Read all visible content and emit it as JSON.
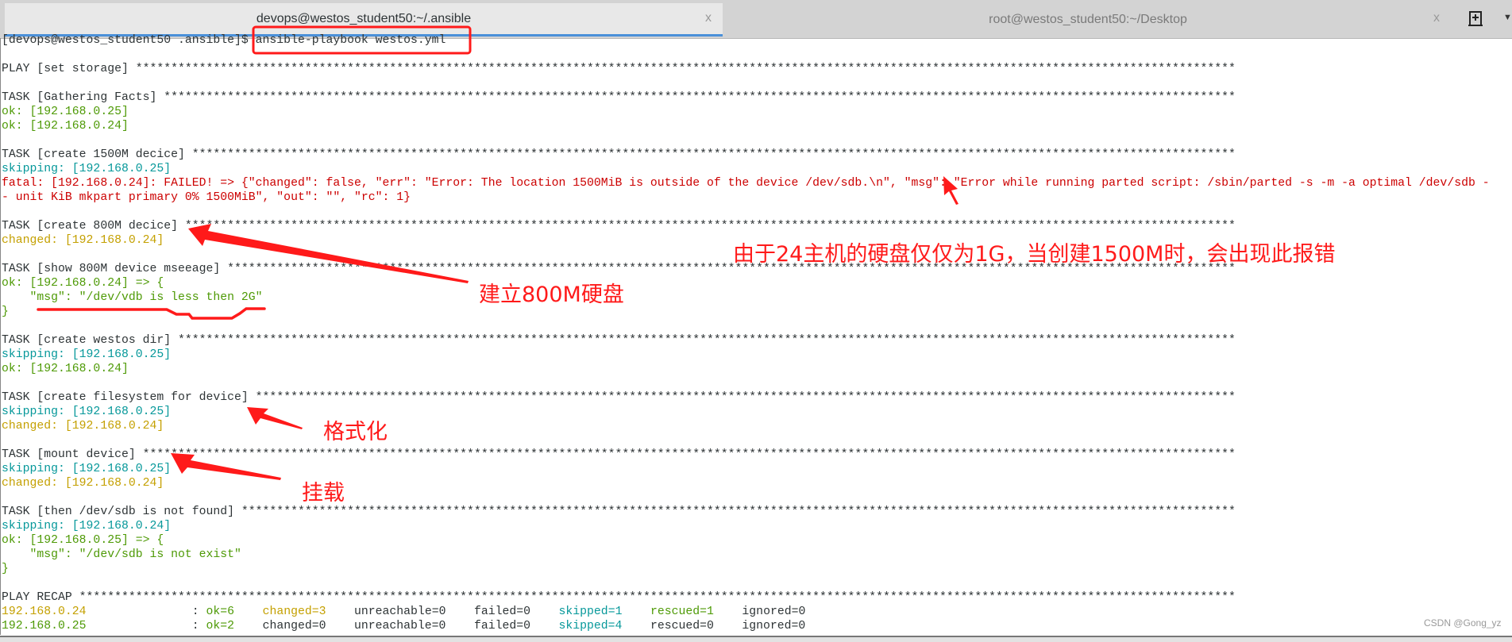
{
  "tabs": [
    {
      "title": "devops@westos_student50:~/.ansible",
      "active": true,
      "close": "x"
    },
    {
      "title": "root@westos_student50:~/Desktop",
      "active": false,
      "close": "x"
    }
  ],
  "icons": {
    "new_tab": "new-tab-icon",
    "menu": "chevron-down-icon"
  },
  "colors": {
    "ok": "#4e9a06",
    "skipping": "#06989a",
    "changed": "#c4a000",
    "fatal": "#cc0000",
    "annotation": "#ff1a1a",
    "tab_accent": "#4a90d9"
  },
  "terminal": {
    "rule_char": "*",
    "lines": [
      [
        {
          "t": "[devops@westos_student50 .ansible]$ ansible-playbook westos.yml",
          "c": "grey"
        }
      ],
      [],
      [
        {
          "t": "PLAY [set storage]",
          "c": "grey",
          "rule": true
        }
      ],
      [],
      [
        {
          "t": "TASK [Gathering Facts]",
          "c": "grey",
          "rule": true
        }
      ],
      [
        {
          "t": "ok: [192.168.0.25]",
          "c": "green"
        }
      ],
      [
        {
          "t": "ok: [192.168.0.24]",
          "c": "green"
        }
      ],
      [],
      [
        {
          "t": "TASK [create 1500M decice]",
          "c": "grey",
          "rule": true
        }
      ],
      [
        {
          "t": "skipping: [192.168.0.25]",
          "c": "cyan"
        }
      ],
      [
        {
          "t": "fatal: [192.168.0.24]: FAILED! => {\"changed\": false, \"err\": \"Error: The location 1500MiB is outside of the device /dev/sdb.\\n\", \"msg\": \"Error while running parted script: /sbin/parted -s -m -a optimal /dev/sdb -",
          "c": "red"
        }
      ],
      [
        {
          "t": "- unit KiB mkpart primary 0% 1500MiB\", \"out\": \"\", \"rc\": 1}",
          "c": "red"
        }
      ],
      [],
      [
        {
          "t": "TASK [create 800M decice]",
          "c": "grey",
          "rule": true
        }
      ],
      [
        {
          "t": "changed: [192.168.0.24]",
          "c": "yellow"
        }
      ],
      [],
      [
        {
          "t": "TASK [show 800M device mseeage]",
          "c": "grey",
          "rule": true
        }
      ],
      [
        {
          "t": "ok: [192.168.0.24] => {",
          "c": "green"
        }
      ],
      [
        {
          "t": "    \"msg\": \"/dev/vdb is less then 2G\"",
          "c": "green"
        }
      ],
      [
        {
          "t": "}",
          "c": "green"
        }
      ],
      [],
      [
        {
          "t": "TASK [create westos dir]",
          "c": "grey",
          "rule": true
        }
      ],
      [
        {
          "t": "skipping: [192.168.0.25]",
          "c": "cyan"
        }
      ],
      [
        {
          "t": "ok: [192.168.0.24]",
          "c": "green"
        }
      ],
      [],
      [
        {
          "t": "TASK [create filesystem for device]",
          "c": "grey",
          "rule": true
        }
      ],
      [
        {
          "t": "skipping: [192.168.0.25]",
          "c": "cyan"
        }
      ],
      [
        {
          "t": "changed: [192.168.0.24]",
          "c": "yellow"
        }
      ],
      [],
      [
        {
          "t": "TASK [mount device]",
          "c": "grey",
          "rule": true
        }
      ],
      [
        {
          "t": "skipping: [192.168.0.25]",
          "c": "cyan"
        }
      ],
      [
        {
          "t": "changed: [192.168.0.24]",
          "c": "yellow"
        }
      ],
      [],
      [
        {
          "t": "TASK [then /dev/sdb is not found]",
          "c": "grey",
          "rule": true
        }
      ],
      [
        {
          "t": "skipping: [192.168.0.24]",
          "c": "cyan"
        }
      ],
      [
        {
          "t": "ok: [192.168.0.25] => {",
          "c": "green"
        }
      ],
      [
        {
          "t": "    \"msg\": \"/dev/sdb is not exist\"",
          "c": "green"
        }
      ],
      [
        {
          "t": "}",
          "c": "green"
        }
      ],
      [],
      [
        {
          "t": "PLAY RECAP",
          "c": "grey",
          "rule": true
        }
      ],
      [
        {
          "t": "192.168.0.24",
          "c": "yellow"
        },
        {
          "t": "               : ",
          "c": "grey"
        },
        {
          "t": "ok=6",
          "c": "green"
        },
        {
          "t": "    ",
          "c": "grey"
        },
        {
          "t": "changed=3",
          "c": "yellow"
        },
        {
          "t": "    unreachable=0    failed=0    ",
          "c": "grey"
        },
        {
          "t": "skipped=1",
          "c": "cyan"
        },
        {
          "t": "    ",
          "c": "grey"
        },
        {
          "t": "rescued=1",
          "c": "green"
        },
        {
          "t": "    ignored=0",
          "c": "grey"
        }
      ],
      [
        {
          "t": "192.168.0.25",
          "c": "green"
        },
        {
          "t": "               : ",
          "c": "grey"
        },
        {
          "t": "ok=2",
          "c": "green"
        },
        {
          "t": "    changed=0    unreachable=0    failed=0    ",
          "c": "grey"
        },
        {
          "t": "skipped=4",
          "c": "cyan"
        },
        {
          "t": "    rescued=0    ignored=0",
          "c": "grey"
        }
      ]
    ]
  },
  "annotations": {
    "error_note": "由于24主机的硬盘仅仅为1G，当创建1500M时，会出现此报错",
    "create_800m": "建立800M硬盘",
    "format": "格式化",
    "mount": "挂载"
  },
  "watermark": "CSDN @Gong_yz"
}
